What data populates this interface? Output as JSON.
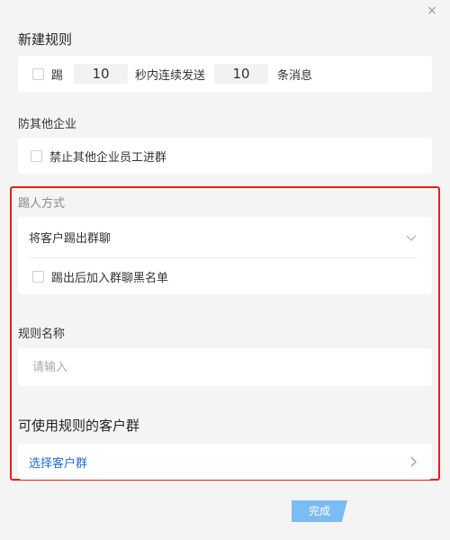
{
  "dialog": {
    "title": "新建规则",
    "close_glyph": "×"
  },
  "kick_rule": {
    "prefix": "踢",
    "seconds": "10",
    "middle": "秒内连续发送",
    "count": "10",
    "suffix": "条消息",
    "checked": false
  },
  "prevent_other": {
    "section_title": "防其他企业",
    "option_label": "禁止其他企业员工进群",
    "checked": false
  },
  "kick_method": {
    "section_title": "踢人方式",
    "selected": "将客户踢出群聊",
    "blacklist_label": "踢出后加入群聊黑名单",
    "blacklist_checked": false
  },
  "rule_name": {
    "section_title": "规则名称",
    "placeholder": "请输入",
    "value": ""
  },
  "customer_groups": {
    "section_title": "可使用规则的客户群",
    "select_label": "选择客户群"
  },
  "footer": {
    "done_label": "完成"
  },
  "colors": {
    "highlight_frame": "#e02020",
    "link": "#1f6fd0",
    "done_button": "#7bbcf2"
  },
  "icons": {
    "close": "close-icon",
    "dropdown": "chevron-down-icon",
    "navigate": "chevron-right-icon"
  }
}
